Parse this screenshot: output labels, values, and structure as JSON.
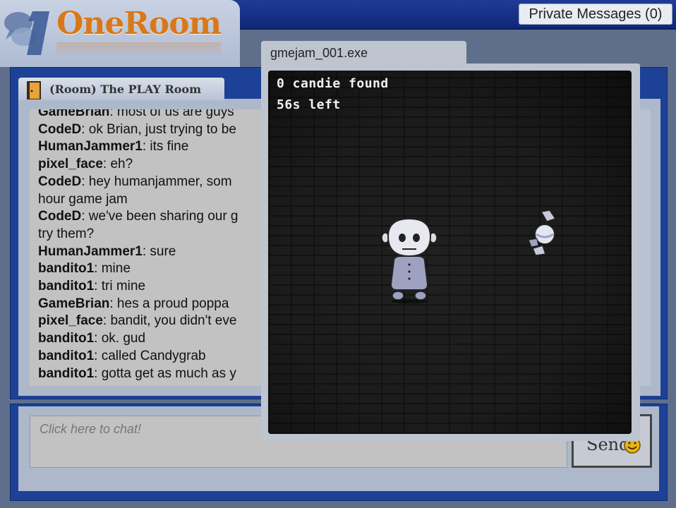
{
  "header": {
    "logo_text": "OneRoom",
    "private_messages_label": "Private Messages (0)"
  },
  "room": {
    "title": "(Room) The PLAY Room"
  },
  "messages": [
    {
      "user": "GameBrian",
      "text": ": most of us are guys"
    },
    {
      "user": "CodeD",
      "text": ": ok Brian, just trying to be"
    },
    {
      "user": "HumanJammer1",
      "text": ": its fine"
    },
    {
      "user": "pixel_face",
      "text": ": eh?"
    },
    {
      "user": "CodeD",
      "text": ": hey humanjammer, som"
    },
    {
      "user": "",
      "text": "hour game jam"
    },
    {
      "user": "CodeD",
      "text": ": we've been sharing our g"
    },
    {
      "user": "",
      "text": "try them?"
    },
    {
      "user": "HumanJammer1",
      "text": ": sure"
    },
    {
      "user": "bandito1",
      "text": ": mine"
    },
    {
      "user": "bandito1",
      "text": ": tri mine"
    },
    {
      "user": "GameBrian",
      "text": ": hes a proud poppa"
    },
    {
      "user": "pixel_face",
      "text": ": bandit, you didn't eve"
    },
    {
      "user": "bandito1",
      "text": ": ok. gud"
    },
    {
      "user": "bandito1",
      "text": ": called Candygrab"
    },
    {
      "user": "bandito1",
      "text": ": gotta get as much as y"
    }
  ],
  "chat_input": {
    "placeholder": "Click here to chat!"
  },
  "send": {
    "label": "Send"
  },
  "game_window": {
    "title": "gmejam_001.exe",
    "candies_found": "0 candie found",
    "time_left": "56s left"
  },
  "colors": {
    "accent_blue": "#1c4196",
    "logo_orange": "#d9781a",
    "panel_gray": "#adb8cb"
  },
  "icons": [
    "speech-bubbles-logo-icon",
    "door-icon",
    "smile-icon",
    "player-sprite-icon",
    "candy-icon"
  ]
}
